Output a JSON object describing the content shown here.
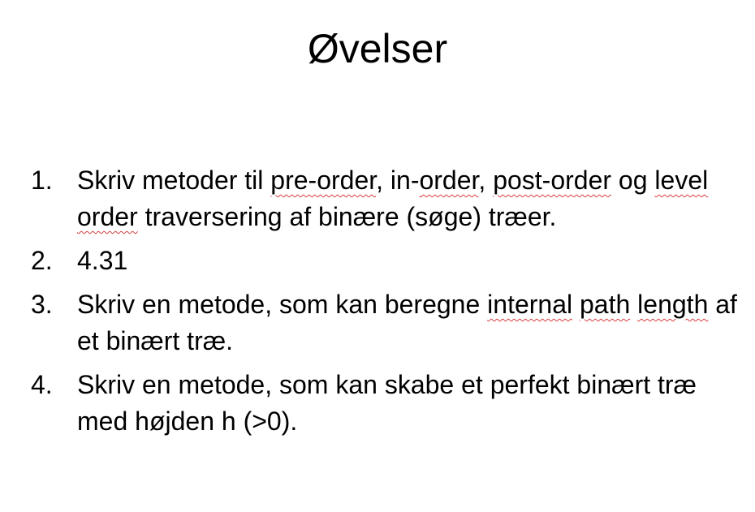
{
  "slide": {
    "title": "Øvelser",
    "items": [
      {
        "number": "1.",
        "parts": [
          "Skriv metoder til ",
          "pre-order",
          ", in-",
          "order",
          ", ",
          "post-order",
          " og ",
          "level",
          " ",
          "order",
          " traversering af binære (søge) træer."
        ]
      },
      {
        "number": "2.",
        "parts": [
          "4.31"
        ]
      },
      {
        "number": "3.",
        "parts": [
          "Skriv en metode, som kan beregne ",
          "internal",
          " ",
          "path",
          " ",
          "length",
          " af et binært træ."
        ]
      },
      {
        "number": "4.",
        "parts": [
          "Skriv en metode, som kan skabe et perfekt binært træ med højden h (>0)."
        ]
      }
    ]
  },
  "colors": {
    "spellcheck_underline": "#d83b3b"
  }
}
